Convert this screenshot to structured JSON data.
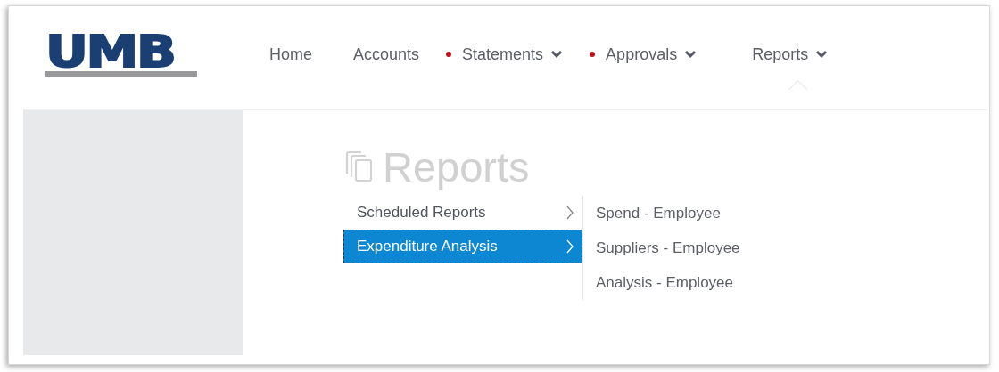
{
  "logo": {
    "text": "UMB"
  },
  "nav": [
    {
      "label": "Home",
      "alert": false,
      "dropdown": false,
      "expanded": false
    },
    {
      "label": "Accounts",
      "alert": false,
      "dropdown": false,
      "expanded": false
    },
    {
      "label": "Statements",
      "alert": true,
      "dropdown": true,
      "expanded": false
    },
    {
      "label": "Approvals",
      "alert": true,
      "dropdown": true,
      "expanded": false
    },
    {
      "label": "Reports",
      "alert": false,
      "dropdown": true,
      "expanded": true
    }
  ],
  "page_title": "Reports",
  "menu": [
    {
      "label": "Scheduled Reports",
      "selected": false
    },
    {
      "label": "Expenditure Analysis",
      "selected": true
    }
  ],
  "submenu": [
    "Spend - Employee",
    "Suppliers - Employee",
    "Analysis - Employee"
  ]
}
